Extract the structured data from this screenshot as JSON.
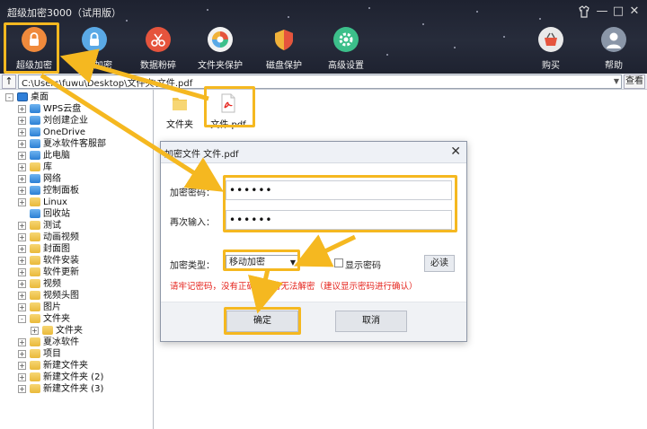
{
  "app": {
    "title": "超级加密3000（试用版）",
    "window_controls": [
      "shirt-icon",
      "minimize-icon",
      "maximize-icon",
      "close-icon"
    ]
  },
  "toolbar": {
    "buttons": [
      {
        "label": "超级加密",
        "icon": "lock-icon",
        "color": "#f08a3c"
      },
      {
        "label": "闪电加密",
        "icon": "lock-icon",
        "color": "#5aa9e6"
      },
      {
        "label": "数据粉碎",
        "icon": "scissors-icon",
        "color": "#e5543d"
      },
      {
        "label": "文件夹保护",
        "icon": "shield-pie-icon",
        "color": "#f2f2f2"
      },
      {
        "label": "磁盘保护",
        "icon": "shield-icon",
        "color": "#f0b23a"
      },
      {
        "label": "高级设置",
        "icon": "gear-icon",
        "color": "#3cbf8a"
      },
      {
        "label": "购买",
        "icon": "basket-icon",
        "color": "#e9e9e9"
      },
      {
        "label": "帮助",
        "icon": "user-icon",
        "color": "#8a96a8"
      }
    ]
  },
  "address": {
    "up_label": "↑",
    "path": "C:\\Users\\fuwu\\Desktop\\文件夹\\文件.pdf",
    "view_label": "查看"
  },
  "tree": {
    "items": [
      {
        "label": "桌面",
        "level": 0,
        "icon": "desktop-icon",
        "expander": "-"
      },
      {
        "label": "WPS云盘",
        "level": 1,
        "icon": "cloud-icon",
        "expander": "+"
      },
      {
        "label": "刘创建企业",
        "level": 1,
        "icon": "user-icon",
        "expander": "+"
      },
      {
        "label": "OneDrive",
        "level": 1,
        "icon": "cloud-icon",
        "expander": "+"
      },
      {
        "label": "夏冰软件客服部",
        "level": 1,
        "icon": "user-icon",
        "expander": "+"
      },
      {
        "label": "此电脑",
        "level": 1,
        "icon": "computer-icon",
        "expander": "+"
      },
      {
        "label": "库",
        "level": 1,
        "icon": "folder-icon",
        "expander": "+"
      },
      {
        "label": "网络",
        "level": 1,
        "icon": "network-icon",
        "expander": "+"
      },
      {
        "label": "控制面板",
        "level": 1,
        "icon": "control-panel-icon",
        "expander": "+"
      },
      {
        "label": "Linux",
        "level": 1,
        "icon": "folder-icon",
        "expander": "+"
      },
      {
        "label": "回收站",
        "level": 1,
        "icon": "recycle-bin-icon",
        "expander": ""
      },
      {
        "label": "测试",
        "level": 1,
        "icon": "folder-icon",
        "expander": "+"
      },
      {
        "label": "动画视频",
        "level": 1,
        "icon": "folder-icon",
        "expander": "+"
      },
      {
        "label": "封面图",
        "level": 1,
        "icon": "folder-icon",
        "expander": "+"
      },
      {
        "label": "软件安装",
        "level": 1,
        "icon": "folder-icon",
        "expander": "+"
      },
      {
        "label": "软件更新",
        "level": 1,
        "icon": "folder-icon",
        "expander": "+"
      },
      {
        "label": "视频",
        "level": 1,
        "icon": "folder-icon",
        "expander": "+"
      },
      {
        "label": "视频头图",
        "level": 1,
        "icon": "folder-icon",
        "expander": "+"
      },
      {
        "label": "图片",
        "level": 1,
        "icon": "folder-icon",
        "expander": "+"
      },
      {
        "label": "文件夹",
        "level": 1,
        "icon": "folder-icon",
        "expander": "-"
      },
      {
        "label": "文件夹",
        "level": 2,
        "icon": "folder-icon",
        "expander": "+"
      },
      {
        "label": "夏冰软件",
        "level": 1,
        "icon": "folder-icon",
        "expander": "+"
      },
      {
        "label": "项目",
        "level": 1,
        "icon": "folder-icon",
        "expander": "+"
      },
      {
        "label": "新建文件夹",
        "level": 1,
        "icon": "folder-icon",
        "expander": "+"
      },
      {
        "label": "新建文件夹 (2)",
        "level": 1,
        "icon": "folder-icon",
        "expander": "+"
      },
      {
        "label": "新建文件夹 (3)",
        "level": 1,
        "icon": "folder-icon",
        "expander": "+"
      }
    ]
  },
  "files": {
    "items": [
      {
        "label": "文件夹",
        "icon": "folder-icon"
      },
      {
        "label": "文件.pdf",
        "icon": "pdf-icon"
      }
    ]
  },
  "dialog": {
    "title": "加密文件 文件.pdf",
    "password_label": "加密密码：",
    "password_value": "••••••",
    "confirm_label": "再次输入：",
    "confirm_value": "••••••",
    "type_label": "加密类型：",
    "type_value": "移动加密",
    "show_password_label": "显示密码",
    "must_read_label": "必读",
    "warning": "请牢记密码，没有正确密码将无法解密（建议显示密码进行确认）",
    "ok_label": "确定",
    "cancel_label": "取消"
  },
  "colors": {
    "highlight": "#f5b820",
    "warning_text": "#e5231c",
    "banner": "#232735"
  }
}
